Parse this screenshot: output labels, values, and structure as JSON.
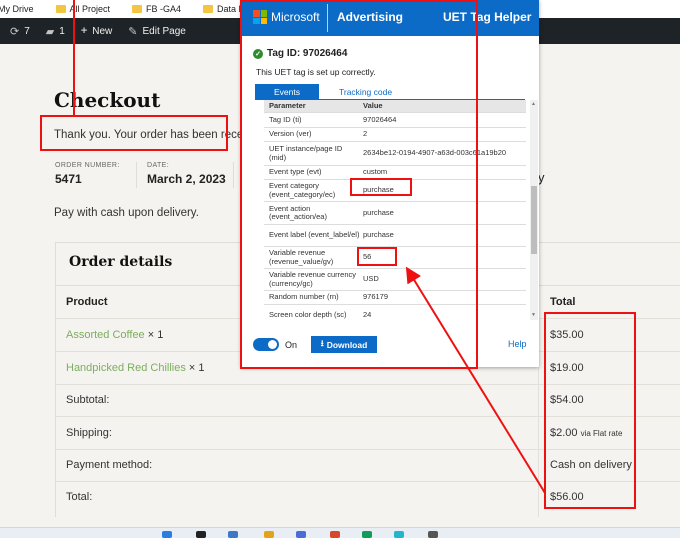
{
  "bookmarks": [
    {
      "label": "My Drive"
    },
    {
      "label": "All Project"
    },
    {
      "label": "FB -GA4"
    },
    {
      "label": "Data Layer"
    }
  ],
  "admin_bar": {
    "updates": "7",
    "comments": "1",
    "new_label": "New",
    "edit_label": "Edit Page"
  },
  "page": {
    "title": "Checkout",
    "thank_you": "Thank you. Your order has been recei",
    "order_number_label": "ORDER NUMBER:",
    "order_number": "5471",
    "date_label": "DATE:",
    "date": "March 2, 2023",
    "partial_right": "y",
    "payment_note": "Pay with cash upon delivery."
  },
  "order_details": {
    "title": "Order details",
    "col_product": "Product",
    "col_total": "Total",
    "items": [
      {
        "name": "Assorted Coffee",
        "qty": "× 1",
        "total": "$35.00"
      },
      {
        "name": "Handpicked Red Chillies",
        "qty": "× 1",
        "total": "$19.00"
      }
    ],
    "subtotal_label": "Subtotal:",
    "subtotal": "$54.00",
    "shipping_label": "Shipping:",
    "shipping": "$2.00",
    "shipping_via": "via Flat rate",
    "payment_label": "Payment method:",
    "payment": "Cash on delivery",
    "total_label": "Total:",
    "total": "$56.00"
  },
  "uet": {
    "brand": "Microsoft",
    "product": "Advertising",
    "helper": "UET Tag Helper",
    "tag_id": "Tag ID: 97026464",
    "setup_msg": "This UET tag is set up correctly.",
    "tab_events": "Events",
    "tab_tracking": "Tracking code",
    "table_head": {
      "param": "Parameter",
      "value": "Value"
    },
    "rows": [
      {
        "param": "Tag ID (ti)",
        "value": "97026464"
      },
      {
        "param": "Version (ver)",
        "value": "2"
      },
      {
        "param": "UET instance/page ID (mid)",
        "value": "2634be12-0194-4907-a63d-003c61a19b20"
      },
      {
        "param": "Event type (evt)",
        "value": "custom"
      },
      {
        "param": "Event category (event_category/ec)",
        "value": "purchase"
      },
      {
        "param": "Event action (event_action/ea)",
        "value": "purchase"
      },
      {
        "param": "Event label (event_label/el)",
        "value": "purchase"
      },
      {
        "param": "Variable revenue (revenue_value/gv)",
        "value": "56"
      },
      {
        "param": "Variable revenue currency (currency/gc)",
        "value": "USD"
      },
      {
        "param": "Random number (rn)",
        "value": "976179"
      },
      {
        "param": "Screen color depth (sc)",
        "value": "24"
      }
    ],
    "toggle_label": "On",
    "download_label": "Download",
    "help_label": "Help"
  },
  "colors": {
    "ms_blue": "#0c6bc6",
    "annotation_red": "#e11111",
    "product_link": "#7cae5d"
  }
}
